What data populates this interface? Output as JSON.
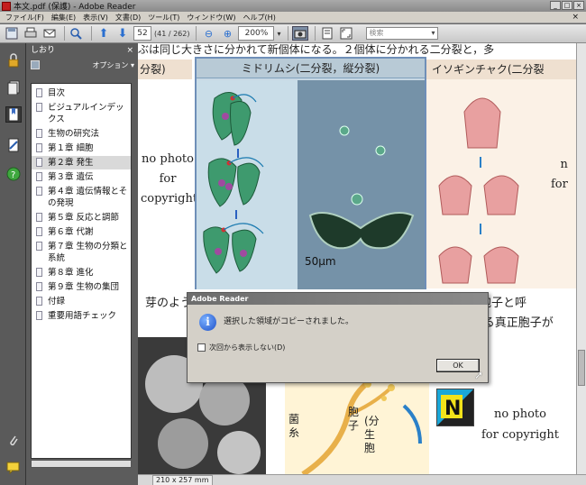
{
  "window": {
    "title": "本文.pdf (保護) - Adobe Reader",
    "controls": [
      "_",
      "□",
      "×"
    ]
  },
  "menu": [
    "ファイル(F)",
    "編集(E)",
    "表示(V)",
    "文書(D)",
    "ツール(T)",
    "ウィンドウ(W)",
    "ヘルプ(H)"
  ],
  "menu_close": "×",
  "toolbar": {
    "page_number": "52",
    "page_count": "(41 / 262)",
    "zoom": "200%",
    "search_placeholder": "検索"
  },
  "bookmarks_panel": {
    "title": "しおり",
    "close": "×",
    "options": "オプション ▾",
    "items": [
      {
        "label": "目次"
      },
      {
        "label": "ビジュアルインデックス"
      },
      {
        "label": "生物の研究法"
      },
      {
        "label": "第１章 細胞"
      },
      {
        "label": "第２章 発生",
        "selected": true
      },
      {
        "label": "第３章 遺伝"
      },
      {
        "label": "第４章 遺伝情報とその発現"
      },
      {
        "label": "第５章 反応と調節"
      },
      {
        "label": "第６章 代謝"
      },
      {
        "label": "第７章 生物の分類と系統"
      },
      {
        "label": "第８章 進化"
      },
      {
        "label": "第９章 生物の集団"
      },
      {
        "label": "付録"
      },
      {
        "label": "重要用語チェック"
      }
    ]
  },
  "document": {
    "top_line": "ぶは同じ大きさに分かれて新個体になる。２個体に分かれる二分裂と，多",
    "left_caption": "分裂)",
    "no_photo_left": [
      "no photo",
      "for",
      "copyright"
    ],
    "figure_caption": "ミドリムシ(二分裂，縦分裂)",
    "scale_label": "50μm",
    "right_caption": "イソギンチャク(二分裂",
    "no_photo_right": [
      "n",
      "for"
    ],
    "mid_left": "芽のよう",
    "mid_right_1": "化した胞子と呼",
    "mid_right_2": "きる真正胞子が",
    "hypha_label": "菌糸",
    "spore_label": "胞子",
    "division_label": "(分生胞",
    "no_photo_bottom": [
      "no photo",
      "for copyright"
    ],
    "page_size": "210 x 257 mm"
  },
  "dialog": {
    "title": "Adobe Reader",
    "message": "選択した領域がコピーされました。",
    "checkbox_label": "次回から表示しない(D)",
    "ok": "OK"
  }
}
